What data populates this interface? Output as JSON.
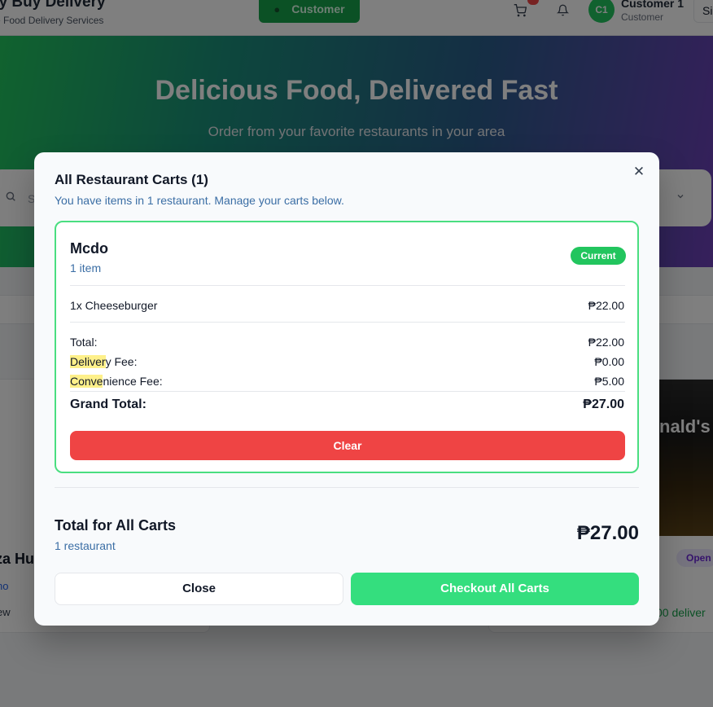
{
  "header": {
    "brand_title": "sy Buy Delivery",
    "brand_subtitle": "e Food Delivery Services",
    "role_label": "Customer",
    "avatar_initials": "C1",
    "user_name": "Customer 1",
    "user_role": "Customer",
    "signout_label": "Si"
  },
  "hero": {
    "title": "Delicious Food, Delivered Fast",
    "subtitle": "Order from your favorite restaurants in your area",
    "search_partial": "S"
  },
  "background_cards": {
    "left_name": "za Hu",
    "left_cuisine": "no",
    "left_view": "ew",
    "right_logo": "nald's",
    "right_status": "Open",
    "right_delivery": "00 deliver"
  },
  "modal": {
    "title": "All Restaurant Carts (1)",
    "description": "You have items in 1 restaurant. Manage your carts below.",
    "cart": {
      "restaurant_name": "Mcdo",
      "item_count": "1 item",
      "badge": "Current",
      "items": [
        {
          "label": "1x Cheeseburger",
          "price": "₱22.00"
        }
      ],
      "total_label": "Total:",
      "total_value": "₱22.00",
      "delivery_fee_label_hl": "Deliver",
      "delivery_fee_label_rest": "y Fee:",
      "delivery_fee_value": "₱0.00",
      "convenience_fee_label_hl": "Conve",
      "convenience_fee_label_rest": "nience Fee:",
      "convenience_fee_value": "₱5.00",
      "grand_total_label": "Grand Total:",
      "grand_total_value": "₱27.00",
      "clear_label": "Clear"
    },
    "summary": {
      "label": "Total for All Carts",
      "count": "1 restaurant",
      "value": "₱27.00"
    },
    "close_label": "Close",
    "checkout_label": "Checkout All Carts"
  },
  "colors": {
    "accent_green": "#22c55e",
    "danger_red": "#ef4444",
    "link_blue": "#3b6ea5",
    "highlight_yellow": "#fef08a"
  }
}
